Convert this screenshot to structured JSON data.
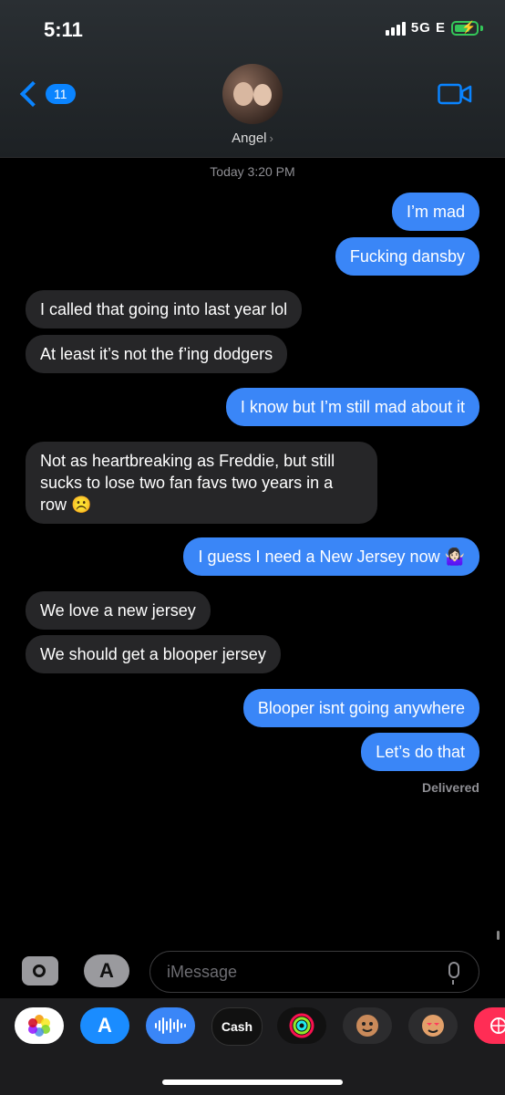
{
  "status_bar": {
    "time": "5:11",
    "network": "5G E"
  },
  "header": {
    "back_count": "11",
    "contact_name": "Angel"
  },
  "conversation": {
    "timestamp": "Today 3:20 PM",
    "delivered": "Delivered",
    "messages": [
      {
        "from": "me",
        "text": "I’m mad"
      },
      {
        "from": "me",
        "text": "Fucking dansby"
      },
      {
        "from": "them",
        "text": "I called that going into last year lol"
      },
      {
        "from": "them",
        "text": "At least it’s not the f’ing dodgers"
      },
      {
        "from": "me",
        "text": "I know but I’m still mad about it"
      },
      {
        "from": "them",
        "text": "Not as heartbreaking as Freddie, but still sucks to lose two fan favs two years in a row ☹️"
      },
      {
        "from": "me",
        "text": "I guess I need a New Jersey now 🤷🏻‍♀️"
      },
      {
        "from": "them",
        "text": "We love a new jersey"
      },
      {
        "from": "them",
        "text": "We should get a blooper jersey"
      },
      {
        "from": "me",
        "text": "Blooper isnt going anywhere"
      },
      {
        "from": "me",
        "text": "Let’s do that"
      }
    ]
  },
  "compose": {
    "placeholder": "iMessage"
  },
  "app_drawer": {
    "apps": [
      {
        "icon": "photos-icon"
      },
      {
        "icon": "app-store-icon"
      },
      {
        "icon": "audio-message-icon"
      },
      {
        "icon": "apple-cash-icon",
        "label": "Cash"
      },
      {
        "icon": "activity-icon"
      },
      {
        "icon": "memoji-icon"
      },
      {
        "icon": "memoji-stickers-icon"
      },
      {
        "icon": "more-apps-icon"
      }
    ]
  },
  "colors": {
    "sent_bubble": "#3a86f7",
    "received_bubble": "#262628",
    "accent": "#0a84ff"
  }
}
